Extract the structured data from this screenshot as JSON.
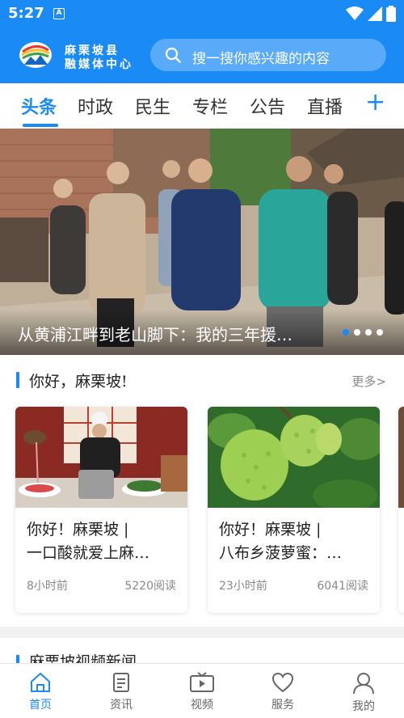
{
  "status": {
    "time": "5:27",
    "badge": "A"
  },
  "header": {
    "logo_line1": "麻栗坡县",
    "logo_line2": "融媒体中心",
    "search_placeholder": "搜一搜你感兴趣的内容"
  },
  "tabs": [
    {
      "label": "头条",
      "active": true
    },
    {
      "label": "时政"
    },
    {
      "label": "民生"
    },
    {
      "label": "专栏"
    },
    {
      "label": "公告"
    },
    {
      "label": "直播"
    }
  ],
  "tabs_add": "+",
  "banner": {
    "caption": "从黄浦江畔到老山脚下：我的三年援…",
    "slide_count": 4,
    "active_slide": 1
  },
  "section1": {
    "title": "你好，麻栗坡!",
    "more": "更多>"
  },
  "cards": [
    {
      "title_line1": "你好！麻栗坡 |",
      "title_line2": "一口酸就爱上麻…",
      "time": "8小时前",
      "reads": "5220阅读"
    },
    {
      "title_line1": "你好！麻栗坡 |",
      "title_line2": "八布乡菠萝蜜：…",
      "time": "23小时前",
      "reads": "6041阅读"
    }
  ],
  "section2": {
    "title": "麻栗坡视频新闻"
  },
  "bottom_nav": [
    {
      "label": "首页",
      "icon": "home-icon",
      "active": true
    },
    {
      "label": "资讯",
      "icon": "news-icon"
    },
    {
      "label": "视频",
      "icon": "video-icon"
    },
    {
      "label": "服务",
      "icon": "heart-icon"
    },
    {
      "label": "我的",
      "icon": "user-icon"
    }
  ],
  "colors": {
    "brand": "#1a8af5",
    "gray_text": "#888888"
  }
}
